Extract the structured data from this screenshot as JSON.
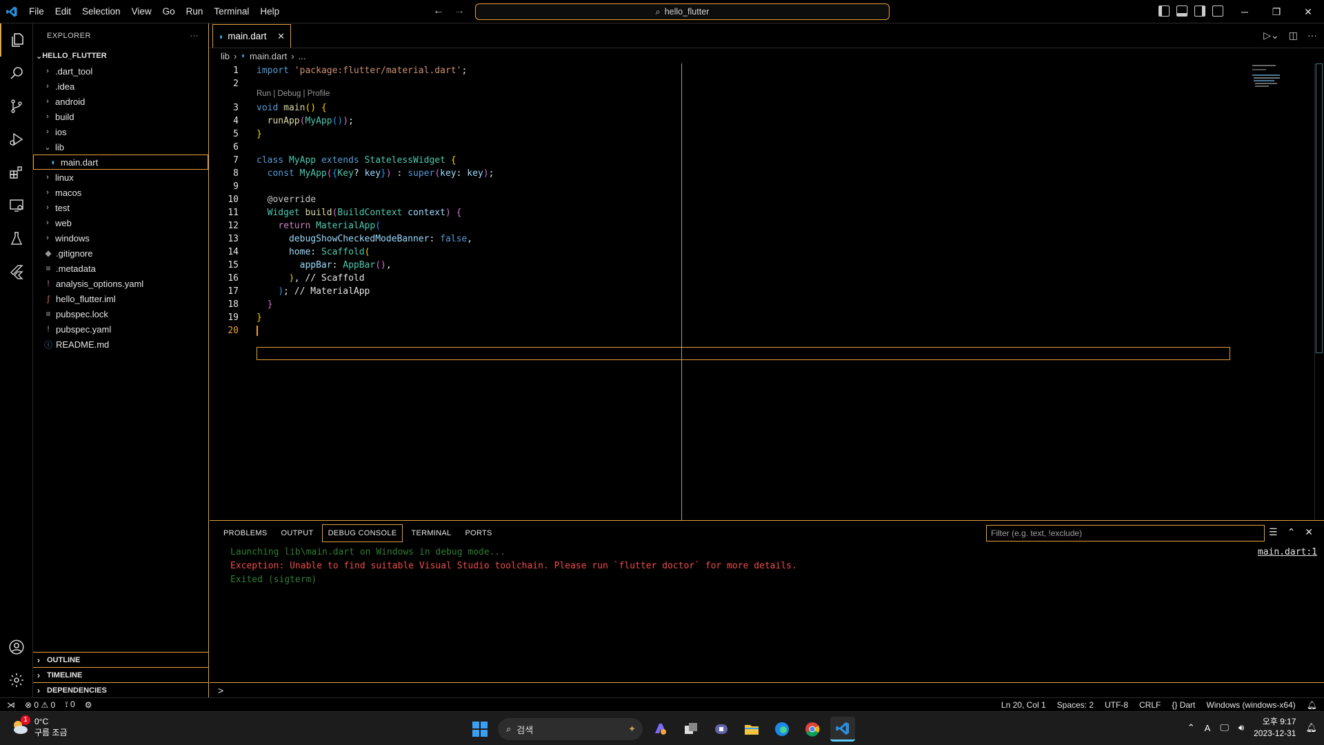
{
  "titlebar": {
    "menu": [
      "File",
      "Edit",
      "Selection",
      "View",
      "Go",
      "Run",
      "Terminal",
      "Help"
    ],
    "search_text": "hello_flutter",
    "accent": "#e7a23c"
  },
  "activitybar": {
    "icons": [
      "explorer-icon",
      "search-icon",
      "source-control-icon",
      "run-debug-icon",
      "extensions-icon",
      "remote-explorer-icon",
      "testing-icon",
      "flutter-icon",
      "account-icon",
      "settings-gear-icon"
    ]
  },
  "sidebar": {
    "title": "EXPLORER",
    "more": "···",
    "root": "HELLO_FLUTTER",
    "items": [
      {
        "label": ".dart_tool",
        "type": "folder"
      },
      {
        "label": ".idea",
        "type": "folder"
      },
      {
        "label": "android",
        "type": "folder"
      },
      {
        "label": "build",
        "type": "folder"
      },
      {
        "label": "ios",
        "type": "folder"
      },
      {
        "label": "lib",
        "type": "folder-open"
      },
      {
        "label": "main.dart",
        "type": "dart-file"
      },
      {
        "label": "linux",
        "type": "folder"
      },
      {
        "label": "macos",
        "type": "folder"
      },
      {
        "label": "test",
        "type": "folder"
      },
      {
        "label": "web",
        "type": "folder"
      },
      {
        "label": "windows",
        "type": "folder"
      },
      {
        "label": ".gitignore",
        "type": "git-file"
      },
      {
        "label": ".metadata",
        "type": "text-file"
      },
      {
        "label": "analysis_options.yaml",
        "type": "yaml-file"
      },
      {
        "label": "hello_flutter.iml",
        "type": "rss-file"
      },
      {
        "label": "pubspec.lock",
        "type": "text-file"
      },
      {
        "label": "pubspec.yaml",
        "type": "yaml-file"
      },
      {
        "label": "README.md",
        "type": "info-file"
      }
    ],
    "sections": [
      "OUTLINE",
      "TIMELINE",
      "DEPENDENCIES"
    ]
  },
  "editor": {
    "tab": "main.dart",
    "breadcrumb": [
      "lib",
      "main.dart",
      "..."
    ],
    "codelens": "Run | Debug | Profile",
    "line_numbers": [
      "1",
      "2",
      "3",
      "4",
      "5",
      "6",
      "7",
      "8",
      "9",
      "10",
      "11",
      "12",
      "13",
      "14",
      "15",
      "16",
      "17",
      "18",
      "19",
      "20"
    ],
    "current_line": "20"
  },
  "panel": {
    "tabs": [
      "PROBLEMS",
      "OUTPUT",
      "DEBUG CONSOLE",
      "TERMINAL",
      "PORTS"
    ],
    "active_tab": "DEBUG CONSOLE",
    "filter_placeholder": "Filter (e.g. text, !exclude)",
    "console": [
      {
        "text": "Launching lib\\main.dart on Windows in debug mode...",
        "color": "#2e7d32"
      },
      {
        "text": "Exception: Unable to find suitable Visual Studio toolchain. Please run `flutter doctor` for more details.",
        "color": "#f14c4c"
      },
      {
        "text": "Exited (sigterm)",
        "color": "#2e7d32"
      }
    ],
    "source_link": "main.dart:1",
    "repl_prompt": ">"
  },
  "statusbar": {
    "errors": "0",
    "warnings": "0",
    "ports": "0",
    "position": "Ln 20, Col 1",
    "spaces": "Spaces: 2",
    "encoding": "UTF-8",
    "eol": "CRLF",
    "language": "Dart",
    "device": "Windows (windows-x64)"
  },
  "taskbar": {
    "temp": "0°C",
    "weather": "구름 조금",
    "weather_badge": "1",
    "search": "검색",
    "time": "오후 9:17",
    "date": "2023-12-31",
    "ime": "A"
  }
}
